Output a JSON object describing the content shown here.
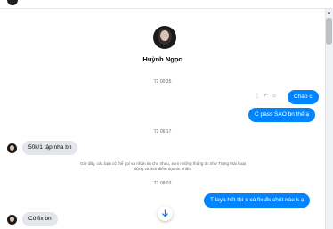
{
  "contact": {
    "name": "Huỳnh Ngọc",
    "avatar_icon": "profile-photo"
  },
  "timestamps": {
    "t1": "T2 00:35",
    "t2": "T2 06:17",
    "t3": "T2 08:03"
  },
  "messages": {
    "out1": "Chào c",
    "out2": "C pass SAO bn thế ạ",
    "in1": "50k/1 tập nha bn",
    "out3": "T laya hết thì c có fix đc chút nào k ạ",
    "in2": "Có fix bn"
  },
  "notice": "Giờ đây, các bạn có thể gọi và nhắn tin cho nhau, xem những thông tin như Trạng thái hoạt động và thời điểm đọc tin nhắn.",
  "message_actions": [
    "more-icon",
    "reply-icon",
    "react-icon"
  ],
  "scroll_down_icon": "arrow-down-icon",
  "colors": {
    "outgoing": "#0084ff",
    "incoming": "#e4e6eb",
    "accent": "#0084ff"
  }
}
